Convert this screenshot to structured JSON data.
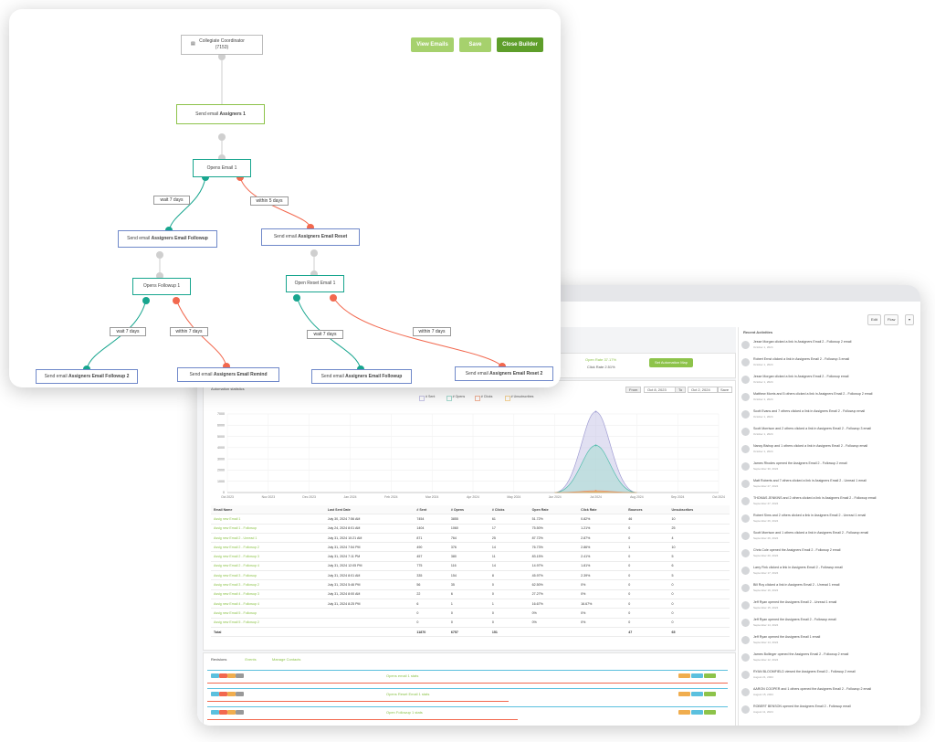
{
  "builder": {
    "buttons": {
      "view_emails": "View Emails",
      "save": "Save",
      "close": "Close Builder"
    },
    "trigger": {
      "line1": "Collegiate Coordinator",
      "line2": "(7153)"
    },
    "nodes": {
      "send1": {
        "prefix": "Send email",
        "bold": "Assigners 1"
      },
      "opens1": "Opens Email 1",
      "send_followup": {
        "prefix": "Send email",
        "bold": "Assigners Email Followup"
      },
      "send_reset": {
        "prefix": "Send email",
        "bold": "Assigners Email Reset"
      },
      "opens_followup": "Opens Followup 1",
      "opens_reset": "Open Reset Email 1",
      "send_followup2": {
        "prefix": "Send email",
        "bold": "Assigners Email Followup 2"
      },
      "send_remind": {
        "prefix": "Send email",
        "bold": "Assigners Email Remind"
      },
      "send_followup_b": {
        "prefix": "Send email",
        "bold": "Assigners Email Followup"
      },
      "send_reset2": {
        "prefix": "Send email",
        "bold": "Assigners Email Reset 2"
      }
    },
    "conditions": {
      "wait7_a": "wait 7 days",
      "within5": "within 5 days",
      "wait7_b": "wait 7 days",
      "within7_a": "within 7 days",
      "wait7_c": "wait 7 days",
      "within7_b": "within 7 days"
    }
  },
  "dashboard": {
    "toolbar": {
      "edit": "Edit",
      "flow": "Flow"
    },
    "open_rate": "Open Rate 37.17%",
    "click_rate": "Click Rate 2.51%",
    "set_automation_map": "Set Automation Map",
    "stats_title": "Automation statistics",
    "date_from_label": "From",
    "date_from": "Oct 8, 2023",
    "date_to_label": "To",
    "date_to": "Oct 2, 2024",
    "date_go": "Save",
    "legend": [
      "# Sent",
      "# Opens",
      "# Clicks",
      "# Unsubscribes"
    ],
    "y_ticks": [
      "7000",
      "6000",
      "5000",
      "4000",
      "3000",
      "2000",
      "1000",
      "0"
    ],
    "x_ticks": [
      "Oct 2023",
      "Nov 2023",
      "Dec 2023",
      "Jan 2024",
      "Feb 2024",
      "Mar 2024",
      "Apr 2024",
      "May 2024",
      "Jun 2024",
      "Jul 2024",
      "Aug 2024",
      "Sep 2024",
      "Oct 2024"
    ],
    "table": {
      "headers": [
        "Email Name",
        "Last Sent Date",
        "# Sent",
        "# Opens",
        "# Clicks",
        "Open Rate",
        "Click Rate",
        "Bounces",
        "Unsubscribes"
      ],
      "rows": [
        [
          "Assig new Email 1",
          "July 30, 2024 7:56 AM",
          "7454",
          "3855",
          "61",
          "51.72%",
          "0.82%",
          "46",
          "10"
        ],
        [
          "Assig new Email 1 - Followup",
          "July 24, 2024 8:01 AM",
          "1404",
          "1060",
          "17",
          "75.50%",
          "1.21%",
          "0",
          "25"
        ],
        [
          "Assig new Email 2 - Unread 1",
          "July 31, 2024 10:21 AM",
          "871",
          "764",
          "25",
          "87.72%",
          "2.87%",
          "0",
          "4"
        ],
        [
          "Assig new Email 2 - Followup 2",
          "July 31, 2024 7:54 PM",
          "490",
          "376",
          "14",
          "76.73%",
          "2.86%",
          "1",
          "10"
        ],
        [
          "Assig new Email 2 - Followup 3",
          "July 31, 2024 7:11 PM",
          "457",
          "380",
          "11",
          "83.15%",
          "2.41%",
          "0",
          "5"
        ],
        [
          "Assig new Email 2 - Followup 4",
          "July 31, 2024 12:05 PM",
          "775",
          "116",
          "14",
          "14.97%",
          "1.81%",
          "0",
          "6"
        ],
        [
          "Assig new Email 3 - Followup",
          "July 31, 2024 8:01 AM",
          "335",
          "154",
          "8",
          "45.97%",
          "2.39%",
          "0",
          "5"
        ],
        [
          "Assig new Email 3 - Followup 2",
          "July 31, 2024 5:46 PM",
          "56",
          "35",
          "0",
          "62.50%",
          "0%",
          "0",
          "0"
        ],
        [
          "Assig new Email 4 - Followup 3",
          "July 31, 2024 8:00 AM",
          "22",
          "6",
          "0",
          "27.27%",
          "0%",
          "0",
          "0"
        ],
        [
          "Assig new Email 4 - Followup 4",
          "July 31, 2024 8:25 PM",
          "6",
          "1",
          "1",
          "16.67%",
          "16.67%",
          "0",
          "0"
        ],
        [
          "Assig new Email 5 - Followup",
          "",
          "0",
          "0",
          "0",
          "0%",
          "0%",
          "0",
          "0"
        ],
        [
          "Assig new Email 5 - Followup 2",
          "",
          "0",
          "0",
          "0",
          "0%",
          "0%",
          "0",
          "0"
        ]
      ],
      "total": [
        "Total",
        "",
        "11870",
        "6757",
        "151",
        "",
        "",
        "47",
        "65"
      ]
    },
    "tabs": [
      "Revisions",
      "Events",
      "Manage Contacts"
    ],
    "rev_rows": [
      {
        "label": "Opens email 1",
        "suffix": "stats"
      },
      {
        "label": "Opens Reset Email 1",
        "suffix": "stats"
      },
      {
        "label": "Open Followup 1",
        "suffix": "stats"
      }
    ],
    "activity_title": "Recent Activities",
    "activities": [
      {
        "text": "Jesse Morgan clicked a link in Assigners Email 2 - Followup 2 email",
        "date": "October 1, 2024"
      },
      {
        "text": "Robert Ernst clicked a link in Assigners Email 2 - Followup 3 email",
        "date": "October 1, 2024"
      },
      {
        "text": "Jesse Morgan clicked a link in Assigners Email 2 - Followup email",
        "date": "October 1, 2024"
      },
      {
        "text": "Matthew Morris and 5 others clicked a link in Assigners Email 2 - Followup 2 email",
        "date": "October 1, 2024"
      },
      {
        "text": "Scott Evans and 7 others clicked a link in Assigners Email 2 - Followup email",
        "date": "October 1, 2024"
      },
      {
        "text": "Scott Morrison and 2 others clicked a link in Assigners Email 2 - Followup 3 email",
        "date": "October 1, 2024"
      },
      {
        "text": "Nancy Bishop and 1 others clicked a link in Assigners Email 2 - Followup email",
        "date": "October 1, 2024"
      },
      {
        "text": "James Rhodes opened the Assigners Email 2 - Followup 2 email",
        "date": "September 30, 2024"
      },
      {
        "text": "Matt Roberts and 7 others clicked a link in Assigners Email 2 - Unread 1 email",
        "date": "September 27, 2024"
      },
      {
        "text": "THOMAS JENKINS and 2 others clicked a link in Assigners Email 2 - Followup email",
        "date": "September 27, 2024"
      },
      {
        "text": "Robert Sims and 2 others clicked a link in Assigners Email 2 - Unread 1 email",
        "date": "September 26, 2024"
      },
      {
        "text": "Scott Morrison and 1 others clicked a link in Assigners Email 2 - Followup email",
        "date": "September 26, 2024"
      },
      {
        "text": "Chris Cole opened the Assigners Email 2 - Followup 2 email",
        "date": "September 20, 2024"
      },
      {
        "text": "Larry Fink clicked a link in Assigners Email 2 - Followup email",
        "date": "September 17, 2024"
      },
      {
        "text": "Bill Roy clicked a link in Assigners Email 2 - Unread 1 email",
        "date": "September 16, 2024"
      },
      {
        "text": "Jeff Ryan opened the Assigners Email 2 - Unread 1 email",
        "date": "September 15, 2024"
      },
      {
        "text": "Jeff Ryan opened the Assigners Email 2 - Followup email",
        "date": "September 14, 2024"
      },
      {
        "text": "Jeff Ryan opened the Assigners Email 1 email",
        "date": "September 14, 2024"
      },
      {
        "text": "James Bollinger opened the Assigners Email 2 - Followup 2 email",
        "date": "September 12, 2024"
      },
      {
        "text": "RYAN BLOOMFIELD viewed the Assigners Email 2 - Followup 2 email",
        "date": "August 21, 2024"
      },
      {
        "text": "AARON COOPER and 1 others opened the Assigners Email 2 - Followup 2 email",
        "date": "August 15, 2024"
      },
      {
        "text": "ROBERT BENSON opened the Assigners Email 2 - Followup email",
        "date": "August 11, 2024"
      }
    ]
  },
  "chart_data": {
    "type": "area",
    "title": "Automation statistics",
    "categories": [
      "Oct 2023",
      "Nov 2023",
      "Dec 2023",
      "Jan 2024",
      "Feb 2024",
      "Mar 2024",
      "Apr 2024",
      "May 2024",
      "Jun 2024",
      "Jul 2024",
      "Aug 2024",
      "Sep 2024",
      "Oct 2024"
    ],
    "ylim": [
      0,
      7000
    ],
    "series": [
      {
        "name": "# Sent",
        "values": [
          0,
          0,
          0,
          0,
          0,
          0,
          0,
          0,
          0,
          7200,
          0,
          0,
          0
        ]
      },
      {
        "name": "# Opens",
        "values": [
          0,
          0,
          0,
          0,
          0,
          0,
          0,
          0,
          0,
          4200,
          0,
          0,
          0
        ]
      },
      {
        "name": "# Clicks",
        "values": [
          0,
          0,
          0,
          0,
          0,
          0,
          0,
          0,
          0,
          150,
          0,
          0,
          0
        ]
      },
      {
        "name": "# Unsubscribes",
        "values": [
          0,
          0,
          0,
          0,
          0,
          0,
          0,
          0,
          0,
          60,
          0,
          0,
          0
        ]
      }
    ],
    "colors": {
      "sent": "#c9c7e8",
      "opens": "#a8dcd2",
      "clicks": "#f3b49a",
      "unsub": "#f6d59a"
    }
  }
}
